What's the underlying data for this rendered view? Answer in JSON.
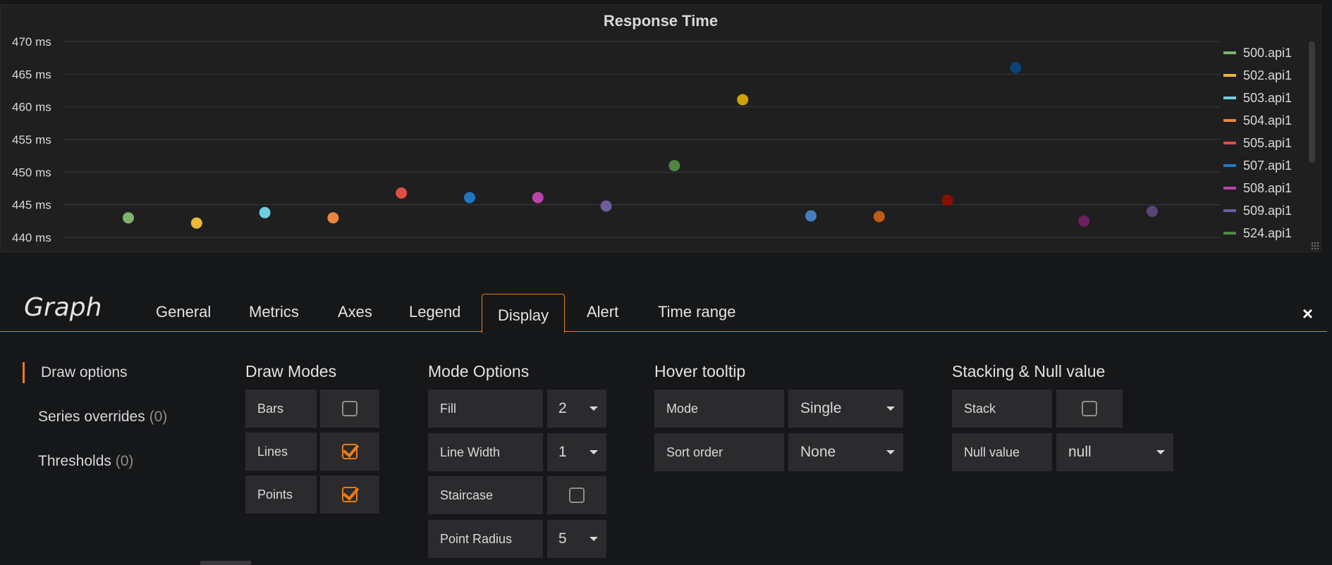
{
  "panel": {
    "title": "Response Time",
    "legend": [
      {
        "name": "500.api1",
        "color": "#7eb26d"
      },
      {
        "name": "502.api1",
        "color": "#eab839"
      },
      {
        "name": "503.api1",
        "color": "#6ed0e0"
      },
      {
        "name": "504.api1",
        "color": "#ef843c"
      },
      {
        "name": "505.api1",
        "color": "#e24d42"
      },
      {
        "name": "507.api1",
        "color": "#1f78c1"
      },
      {
        "name": "508.api1",
        "color": "#ba43a9"
      },
      {
        "name": "509.api1",
        "color": "#705da0"
      },
      {
        "name": "524.api1",
        "color": "#508642"
      }
    ]
  },
  "chart_data": {
    "type": "scatter",
    "title": "Response Time",
    "y_unit": "ms",
    "ylim": [
      440,
      470
    ],
    "y_ticks": [
      "470 ms",
      "465 ms",
      "460 ms",
      "455 ms",
      "450 ms",
      "445 ms",
      "440 ms"
    ],
    "grid": true,
    "legend_position": "right",
    "points": [
      {
        "series": "500.api1",
        "y": 443.0,
        "color": "#7eb26d"
      },
      {
        "series": "502.api1",
        "y": 442.2,
        "color": "#eab839"
      },
      {
        "series": "503.api1",
        "y": 443.8,
        "color": "#6ed0e0"
      },
      {
        "series": "504.api1",
        "y": 443.0,
        "color": "#ef843c"
      },
      {
        "series": "505.api1",
        "y": 446.8,
        "color": "#e24d42"
      },
      {
        "series": "507.api1",
        "y": 446.1,
        "color": "#1f78c1"
      },
      {
        "series": "508.api1",
        "y": 446.1,
        "color": "#ba43a9"
      },
      {
        "series": "509.api1",
        "y": 444.8,
        "color": "#705da0"
      },
      {
        "series": "524.api1",
        "y": 451.0,
        "color": "#508642"
      },
      {
        "series": "",
        "y": 461.1,
        "color": "#cca300"
      },
      {
        "series": "",
        "y": 443.3,
        "color": "#447ebc"
      },
      {
        "series": "",
        "y": 443.2,
        "color": "#c15c17"
      },
      {
        "series": "",
        "y": 445.7,
        "color": "#890f02"
      },
      {
        "series": "",
        "y": 466.0,
        "color": "#0a437c"
      },
      {
        "series": "",
        "y": 442.5,
        "color": "#6d1f62"
      },
      {
        "series": "",
        "y": 444.0,
        "color": "#584477"
      }
    ]
  },
  "editor": {
    "title": "Graph",
    "tabs": [
      "General",
      "Metrics",
      "Axes",
      "Legend",
      "Display",
      "Alert",
      "Time range"
    ],
    "active_tab": "Display",
    "close_icon": "×",
    "side_nav": {
      "draw_options": "Draw options",
      "series_overrides": "Series overrides",
      "series_overrides_count": "(0)",
      "thresholds": "Thresholds",
      "thresholds_count": "(0)"
    },
    "draw_modes": {
      "title": "Draw Modes",
      "bars": "Bars",
      "bars_checked": false,
      "lines": "Lines",
      "lines_checked": true,
      "points": "Points",
      "points_checked": true
    },
    "mode_options": {
      "title": "Mode Options",
      "fill": "Fill",
      "fill_value": "2",
      "line_width": "Line Width",
      "line_width_value": "1",
      "staircase": "Staircase",
      "staircase_checked": false,
      "point_radius": "Point Radius",
      "point_radius_value": "5"
    },
    "hover_tooltip": {
      "title": "Hover tooltip",
      "mode": "Mode",
      "mode_value": "Single",
      "sort_order": "Sort order",
      "sort_order_value": "None"
    },
    "stacking": {
      "title": "Stacking & Null value",
      "stack": "Stack",
      "stack_checked": false,
      "null_value": "Null value",
      "null_value_value": "null"
    }
  }
}
